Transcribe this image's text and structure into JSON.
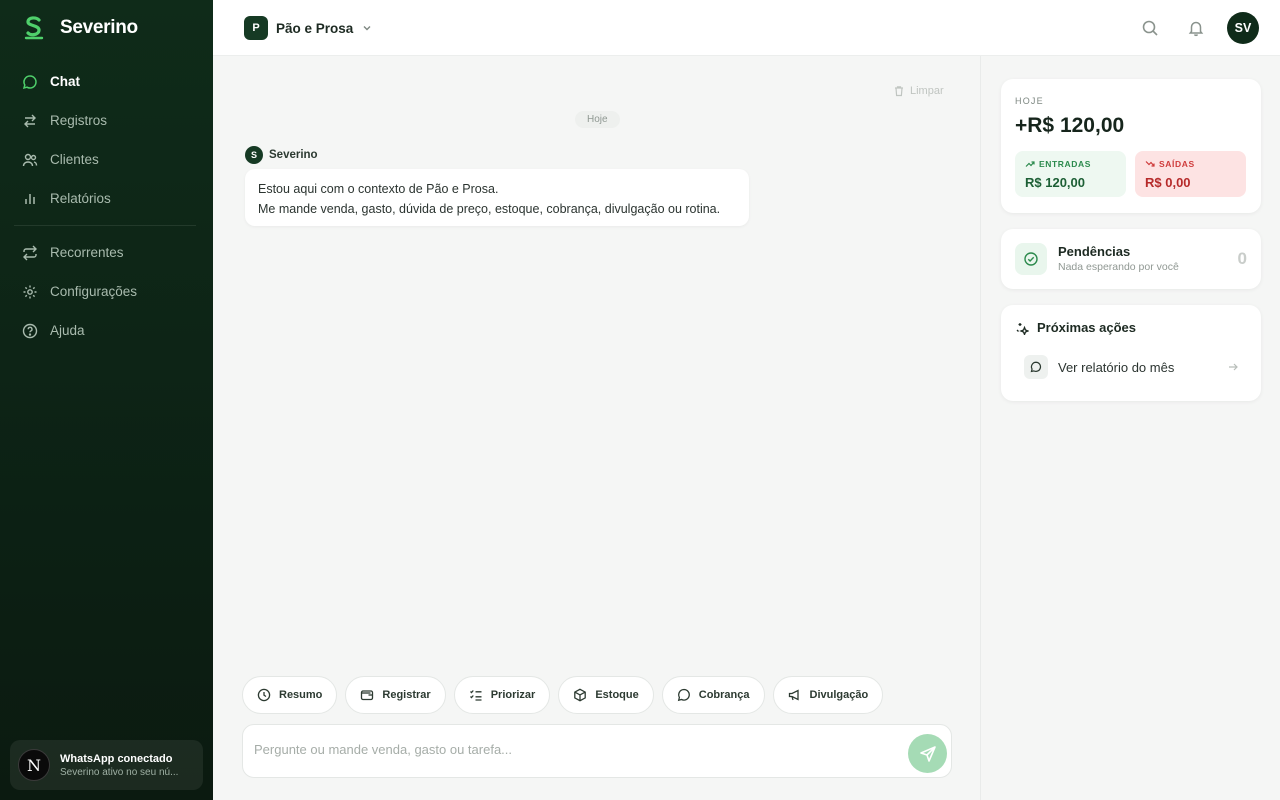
{
  "app": {
    "name": "Severino"
  },
  "sidebar": {
    "items": [
      {
        "label": "Chat",
        "icon": "chat-bubble-icon",
        "active": true
      },
      {
        "label": "Registros",
        "icon": "swap-arrows-icon"
      },
      {
        "label": "Clientes",
        "icon": "users-icon"
      },
      {
        "label": "Relatórios",
        "icon": "bar-chart-icon"
      },
      {
        "label": "Recorrentes",
        "icon": "repeat-icon"
      },
      {
        "label": "Configurações",
        "icon": "gear-icon"
      },
      {
        "label": "Ajuda",
        "icon": "help-circle-icon"
      }
    ],
    "whatsapp": {
      "avatar": "N",
      "title": "WhatsApp conectado",
      "subtitle": "Severino ativo no seu nú..."
    }
  },
  "header": {
    "business_badge": "P",
    "business_name": "Pão e Prosa",
    "user_initials": "SV"
  },
  "chat": {
    "clear_label": "Limpar",
    "day_label": "Hoje",
    "message": {
      "sender_initial": "S",
      "sender": "Severino",
      "line1": "Estou aqui com o contexto de Pão e Prosa.",
      "line2": "Me mande venda, gasto, dúvida de preço, estoque, cobrança, divulgação ou rotina."
    },
    "chips": [
      {
        "label": "Resumo",
        "icon": "clock-icon"
      },
      {
        "label": "Registrar",
        "icon": "wallet-icon"
      },
      {
        "label": "Priorizar",
        "icon": "checklist-icon"
      },
      {
        "label": "Estoque",
        "icon": "box-icon"
      },
      {
        "label": "Cobrança",
        "icon": "chat-bubble-icon"
      },
      {
        "label": "Divulgação",
        "icon": "megaphone-icon"
      }
    ],
    "input_placeholder": "Pergunte ou mande venda, gasto ou tarefa..."
  },
  "summary": {
    "today_label": "HOJE",
    "total": "+R$ 120,00",
    "in_label": "ENTRADAS",
    "in_value": "R$ 120,00",
    "out_label": "SAÍDAS",
    "out_value": "R$ 0,00"
  },
  "pending": {
    "title": "Pendências",
    "subtitle": "Nada esperando por você",
    "count": "0"
  },
  "next_actions": {
    "title": "Próximas ações",
    "items": [
      {
        "label": "Ver relatório do mês"
      }
    ]
  },
  "colors": {
    "sidebar": "#0f2b19",
    "accent": "#163a24",
    "send": "#a5dbb5",
    "in": "#2c8a4d",
    "out": "#cf3b3b"
  }
}
